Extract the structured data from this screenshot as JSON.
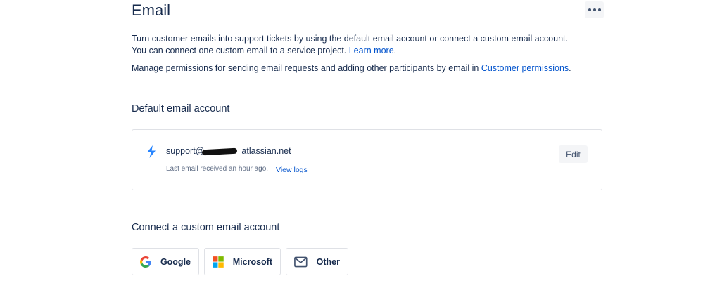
{
  "header": {
    "title": "Email",
    "more_icon": "more-horizontal-icon"
  },
  "intro": {
    "text_before_link": "Turn customer emails into support tickets by using the default email account or connect a custom email account. You can connect one custom email to a service project. ",
    "learn_more_label": "Learn more",
    "text_after_link": ".",
    "permissions_before_link": "Manage permissions for sending email requests and adding other participants by email in ",
    "permissions_link_label": "Customer permissions",
    "permissions_after_link": "."
  },
  "default_account": {
    "heading": "Default email account",
    "icon": "lightning-bolt-icon",
    "email_prefix": "support@",
    "email_suffix": "atlassian.net",
    "status_text": "Last email received an hour ago.",
    "view_logs_label": "View logs",
    "edit_label": "Edit"
  },
  "custom_account": {
    "heading": "Connect a custom email account",
    "providers": [
      {
        "label": "Google",
        "icon": "google-icon"
      },
      {
        "label": "Microsoft",
        "icon": "microsoft-icon"
      },
      {
        "label": "Other",
        "icon": "mail-envelope-icon"
      }
    ]
  },
  "colors": {
    "text": "#172b4d",
    "link": "#0052cc",
    "subtle": "#5e6c84",
    "border": "#dfe1e6",
    "button_bg": "#f4f5f7",
    "bolt": "#2684ff"
  }
}
